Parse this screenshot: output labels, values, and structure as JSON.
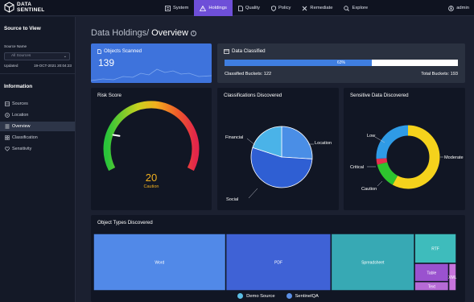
{
  "app": {
    "brand_line1": "DATA",
    "brand_line2": "SENTINEL"
  },
  "nav": [
    {
      "label": "System",
      "icon": "system-icon",
      "active": false
    },
    {
      "label": "Holdings",
      "icon": "warning-triangle-icon",
      "active": true
    },
    {
      "label": "Quality",
      "icon": "document-icon",
      "active": false
    },
    {
      "label": "Policy",
      "icon": "shield-icon",
      "active": false
    },
    {
      "label": "Remediate",
      "icon": "tools-icon",
      "active": false
    },
    {
      "label": "Explore",
      "icon": "search-icon",
      "active": false
    }
  ],
  "user": {
    "name": "admin"
  },
  "sidebar": {
    "source_heading": "Source to View",
    "source_name_label": "Source Name",
    "source_select_value": "All Sources",
    "updated_label": "Updated",
    "updated_value": "19-OCT-2021 20:04:23",
    "info_heading": "Information",
    "items": [
      {
        "label": "Sources",
        "icon": "sources-icon",
        "active": false
      },
      {
        "label": "Location",
        "icon": "location-icon",
        "active": false
      },
      {
        "label": "Overview",
        "icon": "list-icon",
        "active": true
      },
      {
        "label": "Classification",
        "icon": "classification-icon",
        "active": false
      },
      {
        "label": "Sensitivity",
        "icon": "heart-icon",
        "active": false
      }
    ]
  },
  "page": {
    "title_prefix": "Data Holdings/",
    "title_main": "Overview",
    "info_glyph": "i"
  },
  "scanned": {
    "title": "Objects Scanned",
    "count": "139"
  },
  "classified": {
    "title": "Data Classified",
    "percent": 63,
    "percent_label": "63%",
    "classified_label": "Classified Buckets: 122",
    "total_label": "Total Buckets: 193"
  },
  "risk": {
    "title": "Risk Score",
    "value": "20",
    "level": "Caution",
    "gauge_value": 20,
    "gauge_max": 100
  },
  "classifications": {
    "title": "Classifications Discovered"
  },
  "sensitive": {
    "title": "Sensitive Data Discovered"
  },
  "types": {
    "title": "Object Types Discovered"
  },
  "colors": {
    "accent": "#6e4fd8",
    "blue": "#3e73dc",
    "caution": "#f2b01e"
  },
  "chart_data": [
    {
      "type": "pie",
      "title": "Classifications Discovered",
      "labels": [
        "Location",
        "Social",
        "Financial"
      ],
      "values": [
        26,
        54,
        20
      ],
      "colors": [
        "#4a8ee6",
        "#2f5fd3",
        "#4ab3e8"
      ]
    },
    {
      "type": "pie",
      "subtype": "donut",
      "title": "Sensitive Data Discovered",
      "labels": [
        "Moderate",
        "Caution",
        "Critical",
        "Low"
      ],
      "values": [
        58,
        13,
        3,
        26
      ],
      "colors": [
        "#f5d21c",
        "#2ec42e",
        "#e5304e",
        "#2f9be6"
      ]
    },
    {
      "type": "treemap",
      "title": "Object Types Discovered",
      "labels": [
        "Word",
        "PDF",
        "Spreadsheet",
        "RTF",
        "Table",
        "Text",
        "XML"
      ],
      "values": [
        36.5,
        29,
        23,
        6,
        3,
        1.5,
        1
      ],
      "colors": [
        "#5189e8",
        "#3f62d6",
        "#37a9b4",
        "#3ebcbc",
        "#9a52cf",
        "#b66ad6",
        "#c774dc"
      ],
      "legend": [
        {
          "name": "Demo Source",
          "color": "#5bbde4"
        },
        {
          "name": "SentinelQA",
          "color": "#5b8fe6"
        }
      ]
    }
  ]
}
